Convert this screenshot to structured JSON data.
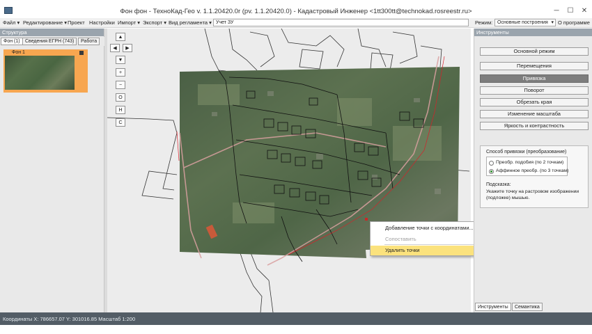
{
  "window": {
    "title": "Фон фон - ТехноКад-Гео v. 1.1.20420.0r (pv. 1.1.20420.0) - Кадастровый Инженер <1tt300tt@technokad.rosreestr.ru>",
    "minimize": "─",
    "maximize": "☐",
    "close": "✕"
  },
  "menu": {
    "items": [
      "Файл ▾",
      "Редактирование ▾",
      "Проект",
      "Настройки",
      "Импорт ▾",
      "Экспорт ▾",
      "Вид регламента ▾"
    ],
    "field": "Учет ЗУ",
    "mode_label": "Режим:",
    "mode_value": "Основные построения",
    "programs": "О программе"
  },
  "left_pane": {
    "header": "Структура",
    "tabs": [
      "Фон (1)",
      "Сведения ЕГРН (743)",
      "Работа"
    ],
    "layer_label": "Фон 1"
  },
  "map": {
    "nav_buttons": [
      "▲",
      "◀",
      "▶",
      "▼",
      "+",
      "−",
      "O",
      "H",
      "C"
    ],
    "context_menu": {
      "items": [
        {
          "label": "Добавление точки с координатами...",
          "state": "normal"
        },
        {
          "label": "Сопоставить",
          "state": "disabled"
        },
        {
          "label": "Удалить точки",
          "state": "highlighted"
        }
      ]
    }
  },
  "right_pane": {
    "header": "Инструменты",
    "buttons": [
      {
        "label": "Основной режим",
        "active": false
      },
      {
        "label": "Перемещения",
        "active": false
      },
      {
        "label": "Привязка",
        "active": true
      },
      {
        "label": "Поворот",
        "active": false
      },
      {
        "label": "Обрезать края",
        "active": false
      },
      {
        "label": "Изменение масштаба",
        "active": false
      },
      {
        "label": "Яркость и контрастность",
        "active": false
      }
    ],
    "binding_method": {
      "title": "Способ привязки (преобразование)",
      "options": [
        {
          "label": "Преобр. подобия (по 2 точкам)",
          "selected": false
        },
        {
          "label": "Аффинное преобр. (по 3 точкам)",
          "selected": true
        }
      ],
      "hint_title": "Подсказка:",
      "hint_text": "Укажите точку на растровом изображении (подложке) мышью."
    },
    "tabs": [
      "Инструменты",
      "Семантика"
    ]
  },
  "status": {
    "text": "Координаты X: 786657.07 Y: 301016.85 Масштаб 1:200"
  },
  "colors": {
    "selected_layer": "#f7a650",
    "context_highlight": "#fbe27d",
    "active_tool": "#7d7d7d",
    "status_bar": "#535d66"
  }
}
